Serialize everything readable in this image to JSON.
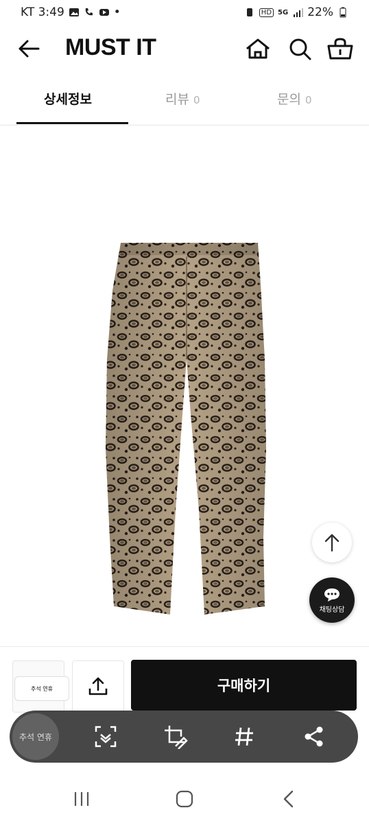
{
  "status_bar": {
    "carrier_time": "KT 3:49",
    "notification_dot": "•",
    "battery": "22%",
    "network_badge": "5G",
    "hd_badge": "HD"
  },
  "header": {
    "logo": "MUST IT",
    "back_icon": "arrow-left-icon",
    "home_icon": "home-icon",
    "search_icon": "search-icon",
    "cart_icon": "basket-icon"
  },
  "tabs": [
    {
      "label": "상세정보",
      "count": ""
    },
    {
      "label": "리뷰",
      "count": "0"
    },
    {
      "label": "문의",
      "count": "0"
    }
  ],
  "product": {
    "image_subject": "leopard print trousers",
    "pattern_colors": {
      "base": "#b8a58a",
      "spot": "#2b221b",
      "mid": "#7d6a55"
    }
  },
  "floating": {
    "scroll_top_icon": "arrow-up-icon",
    "chat_label": "채팅상담"
  },
  "buy_bar": {
    "thumb_text": "추석 연휴",
    "share_icon": "share-upload-icon",
    "buy_label": "구매하기"
  },
  "capture_toolbar": {
    "thumb_text": "추석 연휴",
    "icons": [
      "scan-text-icon",
      "crop-edit-icon",
      "hashtag-icon",
      "share-icon"
    ]
  },
  "nav_bar": {
    "icons": [
      "recents-icon",
      "home-circle-icon",
      "back-chevron-icon"
    ]
  },
  "colors": {
    "primary": "#111111",
    "muted_tab": "#9a9a9a",
    "divider": "#e6e6e6"
  }
}
